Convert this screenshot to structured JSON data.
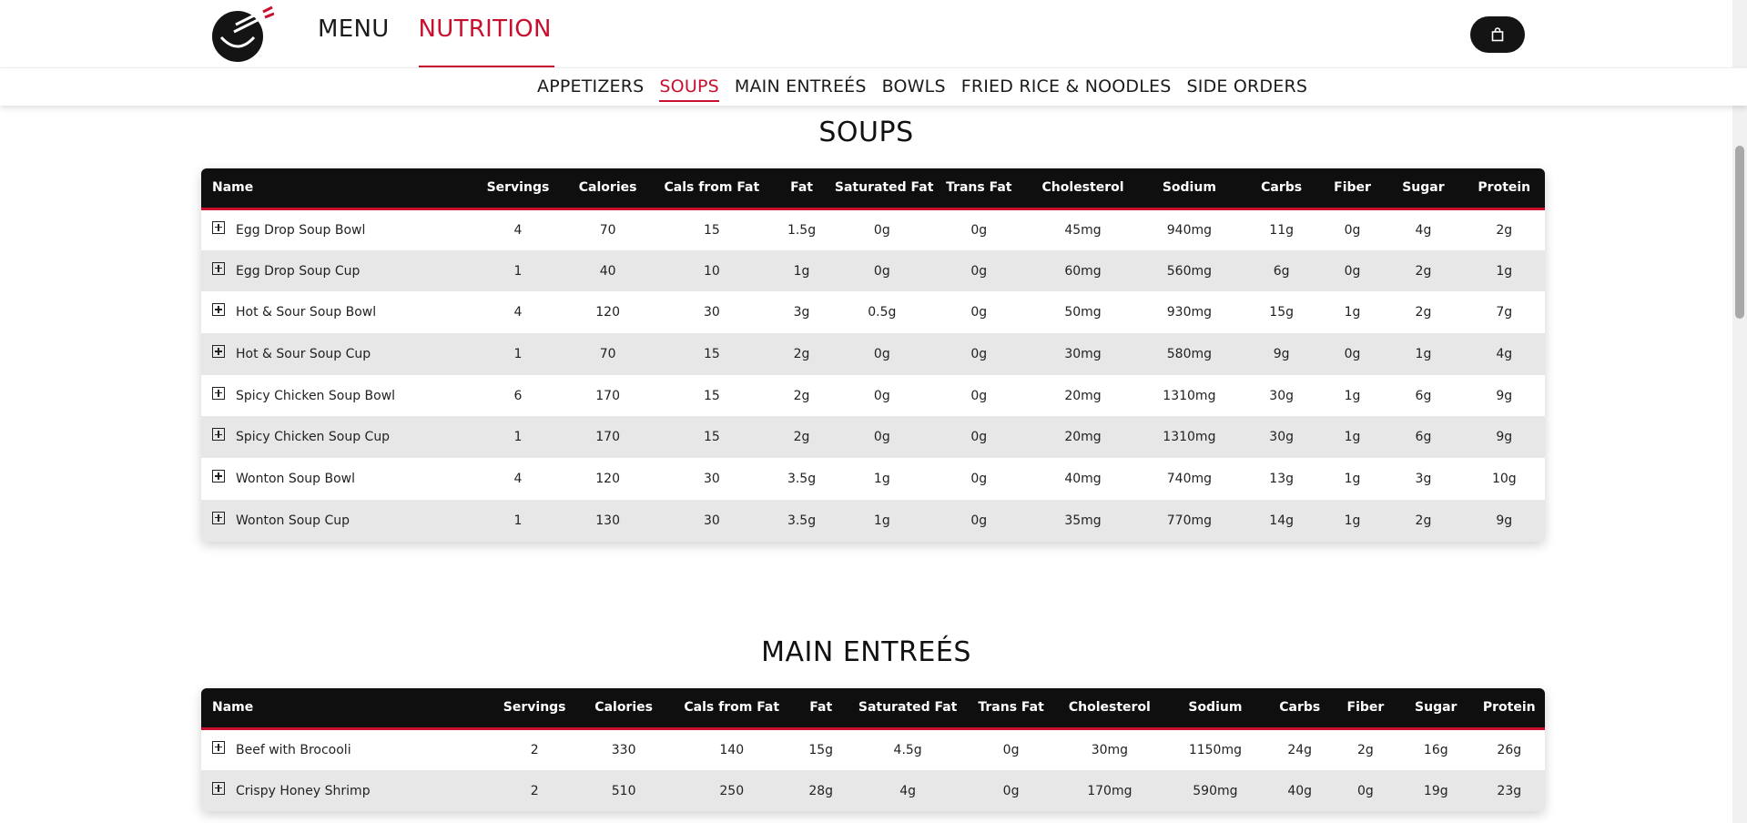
{
  "header": {
    "logo_name": "chopsticks-bowl-logo",
    "nav": [
      {
        "label": "MENU",
        "active": false
      },
      {
        "label": "NUTRITION",
        "active": true
      }
    ],
    "cart_icon": "shopping-bag-icon"
  },
  "subnav": [
    {
      "label": "APPETIZERS",
      "active": false
    },
    {
      "label": "SOUPS",
      "active": true
    },
    {
      "label": "MAIN ENTREÉS",
      "active": false
    },
    {
      "label": "BOWLS",
      "active": false
    },
    {
      "label": "FRIED RICE & NOODLES",
      "active": false
    },
    {
      "label": "SIDE ORDERS",
      "active": false
    }
  ],
  "columns": [
    "Name",
    "Servings",
    "Calories",
    "Cals from Fat",
    "Fat",
    "Saturated Fat",
    "Trans Fat",
    "Cholesterol",
    "Sodium",
    "Carbs",
    "Fiber",
    "Sugar",
    "Protein"
  ],
  "sections": [
    {
      "title": "SOUPS",
      "rows": [
        [
          "Egg Drop Soup Bowl",
          "4",
          "70",
          "15",
          "1.5g",
          "0g",
          "0g",
          "45mg",
          "940mg",
          "11g",
          "0g",
          "4g",
          "2g"
        ],
        [
          "Egg Drop Soup Cup",
          "1",
          "40",
          "10",
          "1g",
          "0g",
          "0g",
          "60mg",
          "560mg",
          "6g",
          "0g",
          "2g",
          "1g"
        ],
        [
          "Hot & Sour Soup Bowl",
          "4",
          "120",
          "30",
          "3g",
          "0.5g",
          "0g",
          "50mg",
          "930mg",
          "15g",
          "1g",
          "2g",
          "7g"
        ],
        [
          "Hot & Sour Soup Cup",
          "1",
          "70",
          "15",
          "2g",
          "0g",
          "0g",
          "30mg",
          "580mg",
          "9g",
          "0g",
          "1g",
          "4g"
        ],
        [
          "Spicy Chicken Soup Bowl",
          "6",
          "170",
          "15",
          "2g",
          "0g",
          "0g",
          "20mg",
          "1310mg",
          "30g",
          "1g",
          "6g",
          "9g"
        ],
        [
          "Spicy Chicken Soup Cup",
          "1",
          "170",
          "15",
          "2g",
          "0g",
          "0g",
          "20mg",
          "1310mg",
          "30g",
          "1g",
          "6g",
          "9g"
        ],
        [
          "Wonton Soup Bowl",
          "4",
          "120",
          "30",
          "3.5g",
          "1g",
          "0g",
          "40mg",
          "740mg",
          "13g",
          "1g",
          "3g",
          "10g"
        ],
        [
          "Wonton Soup Cup",
          "1",
          "130",
          "30",
          "3.5g",
          "1g",
          "0g",
          "35mg",
          "770mg",
          "14g",
          "1g",
          "2g",
          "9g"
        ]
      ]
    },
    {
      "title": "MAIN ENTREÉS",
      "rows": [
        [
          "Beef with Brocooli",
          "2",
          "330",
          "140",
          "15g",
          "4.5g",
          "0g",
          "30mg",
          "1150mg",
          "24g",
          "2g",
          "16g",
          "26g"
        ],
        [
          "Crispy Honey Shrimp",
          "2",
          "510",
          "250",
          "28g",
          "4g",
          "0g",
          "170mg",
          "590mg",
          "40g",
          "0g",
          "19g",
          "23g"
        ]
      ]
    }
  ],
  "colors": {
    "accent": "#c8102e",
    "header_bg": "#0f0f10",
    "row_alt": "#e7e7e7"
  }
}
